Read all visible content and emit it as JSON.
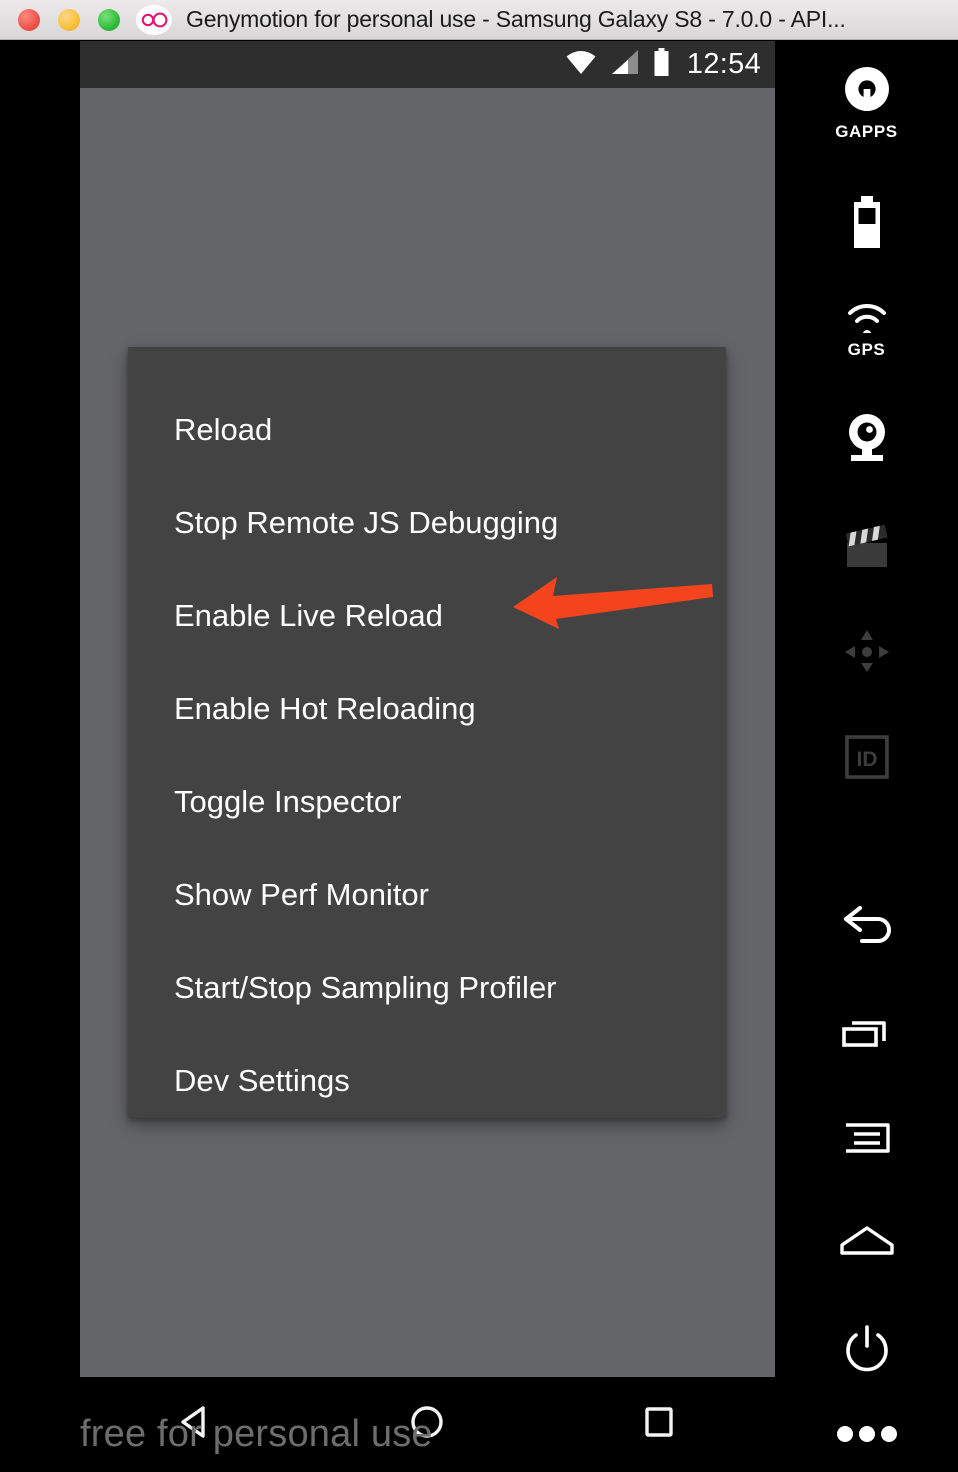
{
  "window": {
    "title": "Genymotion for personal use - Samsung Galaxy S8 - 7.0.0 - API...",
    "logo_icon": "genymotion-goggles-icon",
    "controls": [
      {
        "name": "close-button",
        "color": "#ee5148"
      },
      {
        "name": "minimize-button",
        "color": "#f8bf34"
      },
      {
        "name": "maximize-button",
        "color": "#2dbb3a"
      }
    ]
  },
  "status_bar": {
    "wifi_icon": "wifi-icon",
    "signal_icon": "cellular-signal-icon",
    "battery_icon": "battery-full-icon",
    "clock": "12:54"
  },
  "dev_menu": {
    "items": [
      {
        "label": "Reload",
        "name": "menu-item-reload"
      },
      {
        "label": "Stop Remote JS Debugging",
        "name": "menu-item-stop-remote-js-debugging"
      },
      {
        "label": "Enable Live Reload",
        "name": "menu-item-enable-live-reload"
      },
      {
        "label": "Enable Hot Reloading",
        "name": "menu-item-enable-hot-reloading"
      },
      {
        "label": "Toggle Inspector",
        "name": "menu-item-toggle-inspector"
      },
      {
        "label": "Show Perf Monitor",
        "name": "menu-item-show-perf-monitor"
      },
      {
        "label": "Start/Stop Sampling Profiler",
        "name": "menu-item-start-stop-sampling-profiler"
      },
      {
        "label": "Dev Settings",
        "name": "menu-item-dev-settings"
      }
    ]
  },
  "annotation": {
    "arrow_color": "#f4441e",
    "points_at": "Enable Live Reload",
    "direction": "left"
  },
  "nav_bar": {
    "back_icon": "back-triangle-icon",
    "home_icon": "home-circle-icon",
    "recents_icon": "recents-square-icon"
  },
  "watermark": {
    "text": "free for personal use",
    "color": "#6d6d6d"
  },
  "toolbar": {
    "items": [
      {
        "name": "gapps-icon",
        "label": "GAPPS",
        "enabled": true
      },
      {
        "name": "battery-icon",
        "label": "",
        "enabled": true
      },
      {
        "name": "gps-icon",
        "label": "GPS",
        "enabled": true
      },
      {
        "name": "camera-icon",
        "label": "",
        "enabled": true
      },
      {
        "name": "clapperboard-icon",
        "label": "",
        "enabled": false
      },
      {
        "name": "rotate-move-icon",
        "label": "",
        "enabled": false
      },
      {
        "name": "identifiers-id-icon",
        "label": "",
        "enabled": false
      },
      {
        "name": "back-arrow-icon",
        "label": "",
        "enabled": true
      },
      {
        "name": "recent-apps-icon",
        "label": "",
        "enabled": true
      },
      {
        "name": "menu-icon",
        "label": "",
        "enabled": true
      },
      {
        "name": "home-icon",
        "label": "",
        "enabled": true
      },
      {
        "name": "power-icon",
        "label": "",
        "enabled": true
      },
      {
        "name": "more-options-icon",
        "label": "",
        "enabled": true
      }
    ]
  },
  "colors": {
    "scrim": "#646568",
    "dialog_bg": "#434343",
    "status_bar_bg": "#2e2e2e",
    "toolbar_bg": "#000000",
    "accent_arrow": "#f4441e",
    "menu_text": "#fdfdfd"
  }
}
